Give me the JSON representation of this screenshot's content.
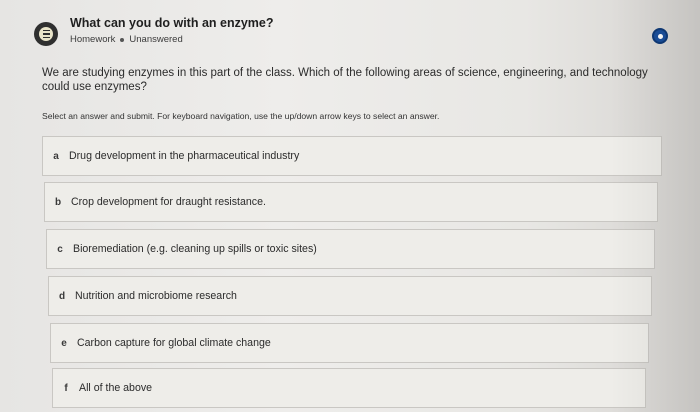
{
  "header": {
    "title": "What can you do with an enzyme?",
    "category": "Homework",
    "status": "Unanswered",
    "icon": "homework-list-icon",
    "info_icon": "info-icon"
  },
  "question": {
    "text": "We are studying enzymes in this part of the class. Which of the following areas of science, engineering, and technology could use enzymes?",
    "instructions": "Select an answer and submit. For keyboard navigation, use the up/down arrow keys to select an answer."
  },
  "options": [
    {
      "letter": "a",
      "text": "Drug development in the pharmaceutical industry"
    },
    {
      "letter": "b",
      "text": "Crop development for draught resistance."
    },
    {
      "letter": "c",
      "text": "Bioremediation (e.g. cleaning up spills or toxic sites)"
    },
    {
      "letter": "d",
      "text": "Nutrition and microbiome research"
    },
    {
      "letter": "e",
      "text": "Carbon capture for global climate change"
    },
    {
      "letter": "f",
      "text": "All of the above"
    }
  ],
  "colors": {
    "accent": "#1a4f9c",
    "icon_dark": "#2f2f2f",
    "option_border": "#c9c7c3"
  }
}
